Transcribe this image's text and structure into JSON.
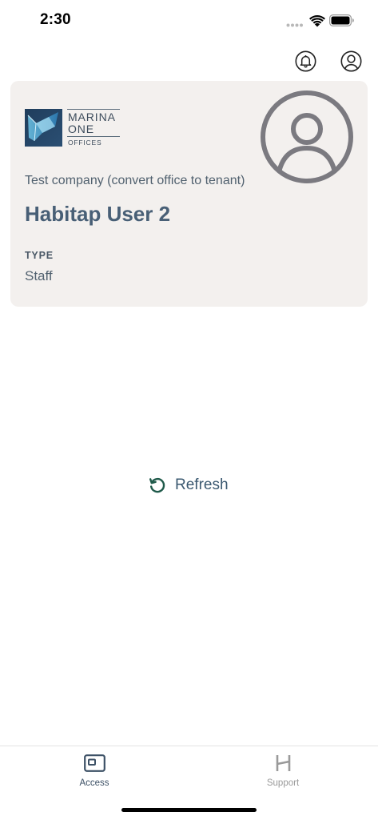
{
  "status_bar": {
    "time": "2:30"
  },
  "header": {
    "notifications_icon": "bell-icon",
    "profile_icon": "account-circle-icon"
  },
  "card": {
    "logo": {
      "line1": "MARINA",
      "line2": "ONE",
      "line3": "OFFICES"
    },
    "avatar_icon": "user-avatar-icon",
    "company": "Test company (convert office to tenant)",
    "user_name": "Habitap User 2",
    "type_label": "TYPE",
    "type_value": "Staff"
  },
  "refresh": {
    "label": "Refresh",
    "icon": "refresh-icon"
  },
  "tabs": [
    {
      "label": "Access",
      "icon": "access-card-icon",
      "active": true
    },
    {
      "label": "Support",
      "icon": "habitap-h-icon",
      "active": false
    }
  ],
  "colors": {
    "card_bg": "#f3f0ee",
    "name_text": "#485f76",
    "refresh_icon": "#1f5a4a",
    "inactive_tab": "#9a9a9a"
  }
}
